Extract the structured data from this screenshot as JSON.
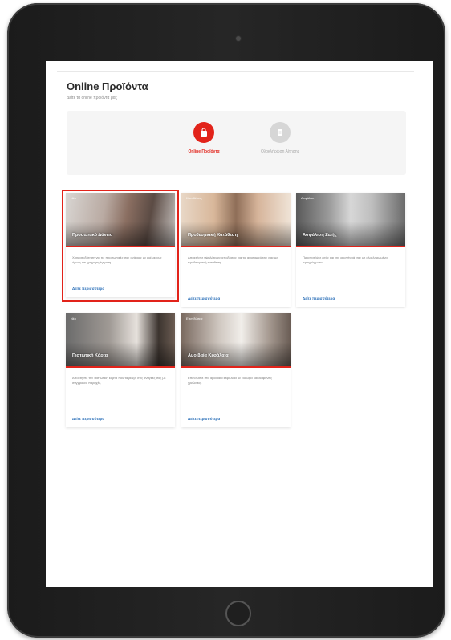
{
  "page": {
    "title": "Online Προϊόντα",
    "subtitle": "Δείτε τα online προϊόντα μας"
  },
  "steps": [
    {
      "label": "Online Προϊόντα",
      "icon": "shopping-bag-icon",
      "state": "active"
    },
    {
      "label": "Ολοκλήρωση Αίτησης",
      "icon": "document-icon",
      "state": "inactive"
    }
  ],
  "cards": [
    {
      "tag": "Νέο",
      "title": "Προσωπικό Δάνειο",
      "description": "Χρηματοδότηση για τις προσωπικές σας ανάγκες με ευέλικτους όρους και γρήγορη έγκριση.",
      "link": "Δείτε περισσότερα",
      "selected": true
    },
    {
      "tag": "Καταθέσεις",
      "title": "Προθεσμιακή Κατάθεση",
      "description": "Αποκτήστε υψηλότερες αποδόσεις για τις αποταμιεύσεις σας με προθεσμιακή κατάθεση.",
      "link": "Δείτε περισσότερα",
      "selected": false
    },
    {
      "tag": "Ασφάλιση",
      "title": "Ασφάλιση Ζωής",
      "description": "Προστατέψτε εσάς και την οικογένειά σας με ολοκληρωμένα προγράμματα.",
      "link": "Δείτε περισσότερα",
      "selected": false
    },
    {
      "tag": "Νέο",
      "title": "Πιστωτική Κάρτα",
      "description": "Αποκτήστε την πιστωτική κάρτα που ταιριάζει στις ανάγκες σας με σύγχρονες παροχές.",
      "link": "Δείτε περισσότερα",
      "selected": false
    },
    {
      "tag": "Επενδύσεις",
      "title": "Αμοιβαία Κεφάλαια",
      "description": "Επενδύστε στα αμοιβαία κεφάλαια με ευελιξία και διαφανείς χρεώσεις.",
      "link": "Δείτε περισσότερα",
      "selected": false
    }
  ],
  "colors": {
    "accent": "#e2231a",
    "link": "#2a6fb8",
    "inactive": "#d6d6d6"
  }
}
